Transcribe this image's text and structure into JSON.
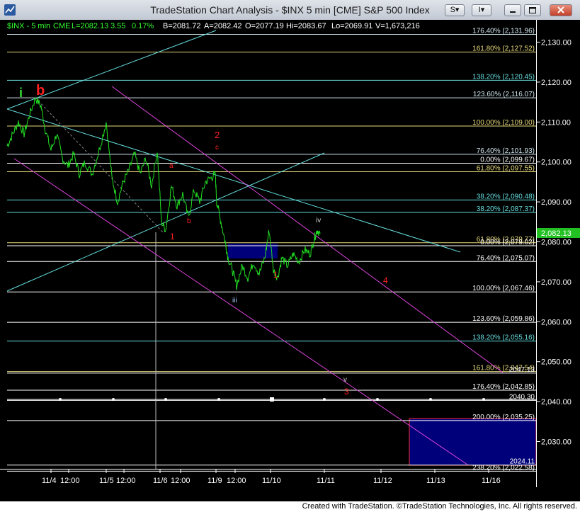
{
  "window": {
    "title": "TradeStation Chart Analysis - $INX 5 min [CME] S&P 500 Index",
    "btn_s": "S",
    "btn_i": "I",
    "dd_arrow": "▾"
  },
  "status": {
    "symbol": "$INX - 5 min",
    "exchange": "CME",
    "last": "L=2082.13",
    "change": "3.55",
    "change_pct": "0.17%",
    "bid": "B=2081.72",
    "ask": "A=2082.42",
    "open": "O=2077.19",
    "high": "Hi=2083.67",
    "low": "Lo=2069.91",
    "volume": "V=1,673,216"
  },
  "price_axis": {
    "ticks": [
      {
        "value": 2130,
        "label": "2,130.00"
      },
      {
        "value": 2120,
        "label": "2,120.00"
      },
      {
        "value": 2110,
        "label": "2,110.00"
      },
      {
        "value": 2100,
        "label": "2,100.00"
      },
      {
        "value": 2090,
        "label": "2,090.00"
      },
      {
        "value": 2080,
        "label": "2,080.00"
      },
      {
        "value": 2070,
        "label": "2,070.00"
      },
      {
        "value": 2060,
        "label": "2,060.00"
      },
      {
        "value": 2050,
        "label": "2,050.00"
      },
      {
        "value": 2040,
        "label": "2,040.00"
      },
      {
        "value": 2030,
        "label": "2,030.00"
      }
    ],
    "last_price": "2,082.13"
  },
  "time_axis": {
    "labels": [
      "11/4",
      "12:00",
      "11/5",
      "12:00",
      "11/6",
      "12:00",
      "11/9",
      "12:00",
      "11/10",
      "11/11",
      "11/12",
      "11/13",
      "11/16"
    ]
  },
  "fib_levels": [
    {
      "price": 2131.96,
      "label": "176.40% (2,131.96)",
      "color": "#cfe6ee"
    },
    {
      "price": 2127.52,
      "label": "161.80% (2,127.52)",
      "color": "#e6d879"
    },
    {
      "price": 2120.45,
      "label": "138.20% (2,120.45)",
      "color": "#66dddd"
    },
    {
      "price": 2116.07,
      "label": "123.60% (2,116.07)",
      "color": "#cfe6ee"
    },
    {
      "price": 2109.0,
      "label": "100.00% (2,109.00)",
      "color": "#e6d879"
    },
    {
      "price": 2101.93,
      "label": "76.40% (2,101.93)",
      "color": "#cfe6ee"
    },
    {
      "price": 2099.67,
      "label": "0.00% (2,099.67)",
      "color": "#ffffff"
    },
    {
      "price": 2097.55,
      "label": "61.80% (2,097.55)",
      "color": "#e6d879"
    },
    {
      "price": 2090.48,
      "label": "38.20% (2,090.48)",
      "color": "#66dddd"
    },
    {
      "price": 2087.37,
      "label": "38.20% (2,087.37)",
      "color": "#66dddd"
    },
    {
      "price": 2079.77,
      "label": "61.80% (2,079.77)",
      "color": "#e6d879"
    },
    {
      "price": 2079.02,
      "label": "0.00% (2,079.02)",
      "color": "#ffffff"
    },
    {
      "price": 2075.07,
      "label": "76.40% (2,075.07)",
      "color": "#ffffff"
    },
    {
      "price": 2067.46,
      "label": "100.00% (2,067.46)",
      "color": "#ffffff"
    },
    {
      "price": 2059.86,
      "label": "123.60% (2,059.86)",
      "color": "#ffffff"
    },
    {
      "price": 2055.16,
      "label": "138.20% (2,055.16)",
      "color": "#66dddd"
    },
    {
      "price": 2047.54,
      "label": "161.80% (2,047.54)",
      "color": "#e6d879"
    },
    {
      "price": 2042.85,
      "label": "176.40% (2,042.85)",
      "color": "#ffffff"
    },
    {
      "price": 2035.25,
      "label": "200.00% (2,035.25)",
      "color": "#ffffff"
    },
    {
      "price": 2022.58,
      "label": "238.20% (2,022.58)",
      "color": "#ffffff"
    }
  ],
  "level_values": [
    {
      "price": 2047.13,
      "label": "2047.13"
    },
    {
      "price": 2040.3,
      "label": "2040.30"
    },
    {
      "price": 2024.11,
      "label": "2024.11"
    }
  ],
  "wave_labels": [
    {
      "text": "i",
      "color": "#33dd33"
    },
    {
      "text": "b",
      "color": "#ff2020"
    },
    {
      "text": "2",
      "color": "#ff2020"
    },
    {
      "text": "c",
      "color": "#ff2020"
    },
    {
      "text": "a",
      "color": "#ff2020"
    },
    {
      "text": "b",
      "color": "#ff2020"
    },
    {
      "text": "1",
      "color": "#ff2020"
    },
    {
      "text": "iv",
      "color": "#cccccc"
    },
    {
      "text": "iii",
      "color": "#aaccff"
    },
    {
      "text": "4",
      "color": "#ff2020"
    },
    {
      "text": "1",
      "color": "#ff2020"
    },
    {
      "text": "v",
      "color": "#cccccc"
    },
    {
      "text": "3",
      "color": "#ff2020"
    }
  ],
  "colors": {
    "price_line": "#22e022",
    "channel_cyan": "#66dddd",
    "channel_magenta": "#dd44dd",
    "box_fill": "#00007a",
    "box_border": "#ff3030"
  },
  "footer": {
    "text": "Created with TradeStation. ©TradeStation Technologies, Inc. All rights reserved."
  }
}
